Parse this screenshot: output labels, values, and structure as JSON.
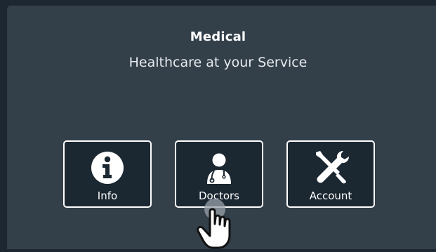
{
  "header": {
    "title": "Medical",
    "subtitle": "Healthcare at your Service"
  },
  "menu": {
    "tiles": [
      {
        "label": "Info",
        "icon": "info-icon"
      },
      {
        "label": "Doctors",
        "icon": "doctor-icon"
      },
      {
        "label": "Account",
        "icon": "tools-icon"
      }
    ]
  },
  "colors": {
    "background": "#1c2731",
    "panel": "#333f49",
    "tile": "#1b2731",
    "accent": "#ffffff"
  }
}
